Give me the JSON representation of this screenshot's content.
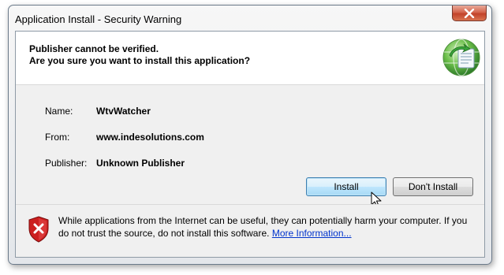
{
  "window": {
    "title": "Application Install - Security Warning"
  },
  "header": {
    "line1": "Publisher cannot be verified.",
    "line2": "Are you sure you want to install this application?",
    "icon": "clickonce-globe-icon"
  },
  "info": {
    "name_label": "Name:",
    "name_value": "WtvWatcher",
    "from_label": "From:",
    "from_value": "www.indesolutions.com",
    "publisher_label": "Publisher:",
    "publisher_value": "Unknown Publisher"
  },
  "buttons": {
    "install": "Install",
    "dont_install": "Don't Install"
  },
  "footer": {
    "warning_text": "While applications from the Internet can be useful, they can potentially harm your computer. If you do not trust the source, do not install this software.",
    "link_text": "More Information...",
    "icon": "security-shield-icon"
  },
  "colors": {
    "link": "#0033cc",
    "shield_red": "#cc1f1f",
    "close_red": "#c2422a"
  }
}
